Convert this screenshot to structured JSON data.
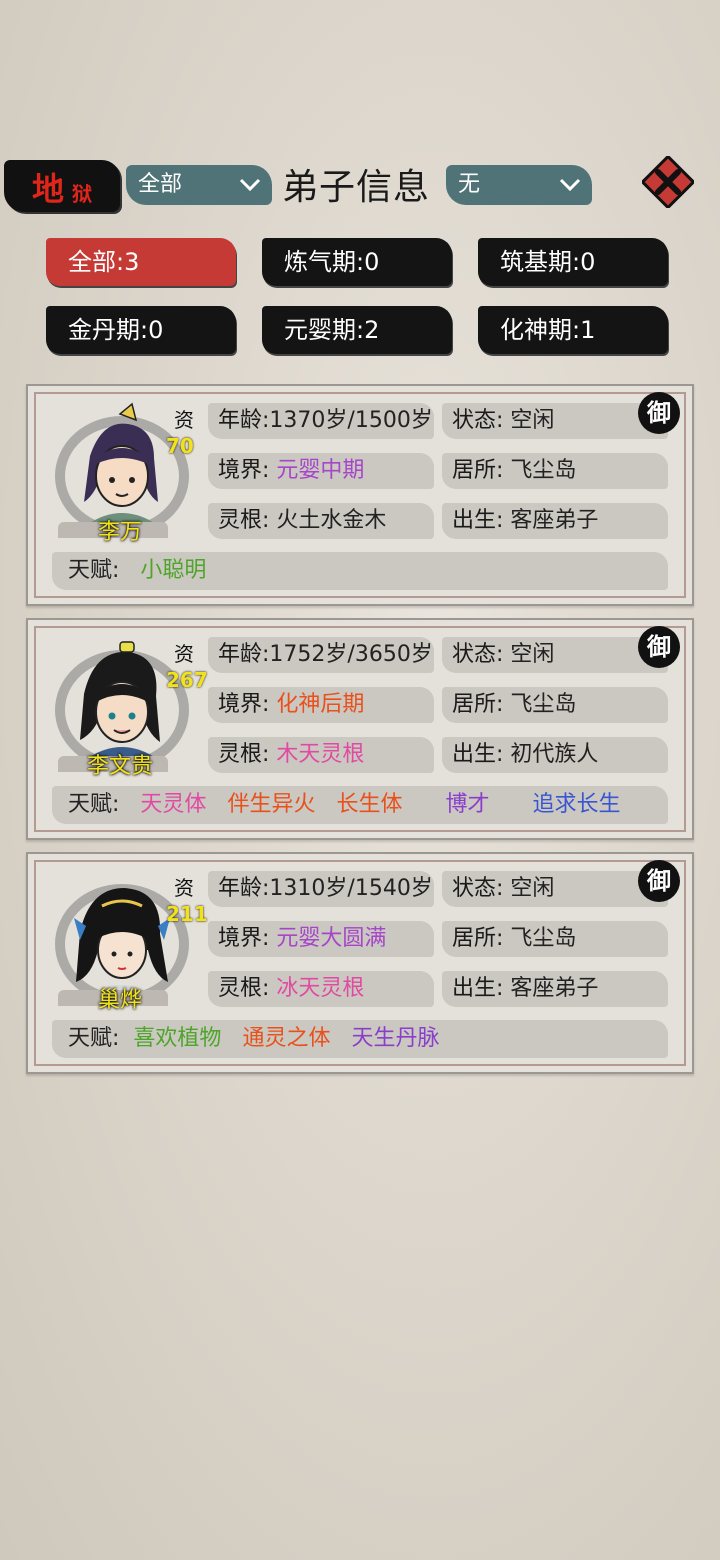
{
  "header": {
    "difficulty_big": "地",
    "difficulty_small": "狱",
    "filter_left": "全部",
    "title": "弟子信息",
    "filter_right": "无"
  },
  "tabs": [
    {
      "label": "全部:3",
      "active": true
    },
    {
      "label": "炼气期:0",
      "active": false
    },
    {
      "label": "筑基期:0",
      "active": false
    },
    {
      "label": "金丹期:0",
      "active": false
    },
    {
      "label": "元婴期:2",
      "active": false
    },
    {
      "label": "化神期:1",
      "active": false
    }
  ],
  "labels": {
    "age": "年龄:",
    "realm": "境界:",
    "root": "灵根:",
    "status": "状态:",
    "residence": "居所:",
    "origin": "出生:",
    "talent": "天赋:",
    "aptitude": "资",
    "seal": "御"
  },
  "disciples": [
    {
      "name": "李万",
      "aptitude": "70",
      "age": "1370岁/1500岁",
      "status": "空闲",
      "realm": "元婴中期",
      "realm_color": "#a646c9",
      "residence": "飞尘岛",
      "root": "火土水金木",
      "root_color": "#1a1a1a",
      "origin": "客座弟子",
      "talents": [
        {
          "text": "小聪明",
          "color": "#4ea52a"
        }
      ]
    },
    {
      "name": "李文贵",
      "aptitude": "267",
      "age": "1752岁/3650岁",
      "status": "空闲",
      "realm": "化神后期",
      "realm_color": "#e8501c",
      "residence": "飞尘岛",
      "root": "木天灵根",
      "root_color": "#e04aa3",
      "origin": "初代族人",
      "talents": [
        {
          "text": "天灵体",
          "color": "#e04aa3"
        },
        {
          "text": "伴生异火",
          "color": "#e8501c"
        },
        {
          "text": "长生体",
          "color": "#e8501c"
        },
        {
          "text": "博才",
          "color": "#8a3fcc"
        },
        {
          "text": "追求长生",
          "color": "#3856d1"
        }
      ]
    },
    {
      "name": "巢烨",
      "aptitude": "211",
      "age": "1310岁/1540岁",
      "status": "空闲",
      "realm": "元婴大圆满",
      "realm_color": "#a646c9",
      "residence": "飞尘岛",
      "root": "冰天灵根",
      "root_color": "#e04aa3",
      "origin": "客座弟子",
      "talents": [
        {
          "text": "喜欢植物",
          "color": "#4ea52a"
        },
        {
          "text": "通灵之体",
          "color": "#e8501c"
        },
        {
          "text": "天生丹脉",
          "color": "#8a3fcc"
        }
      ]
    }
  ]
}
